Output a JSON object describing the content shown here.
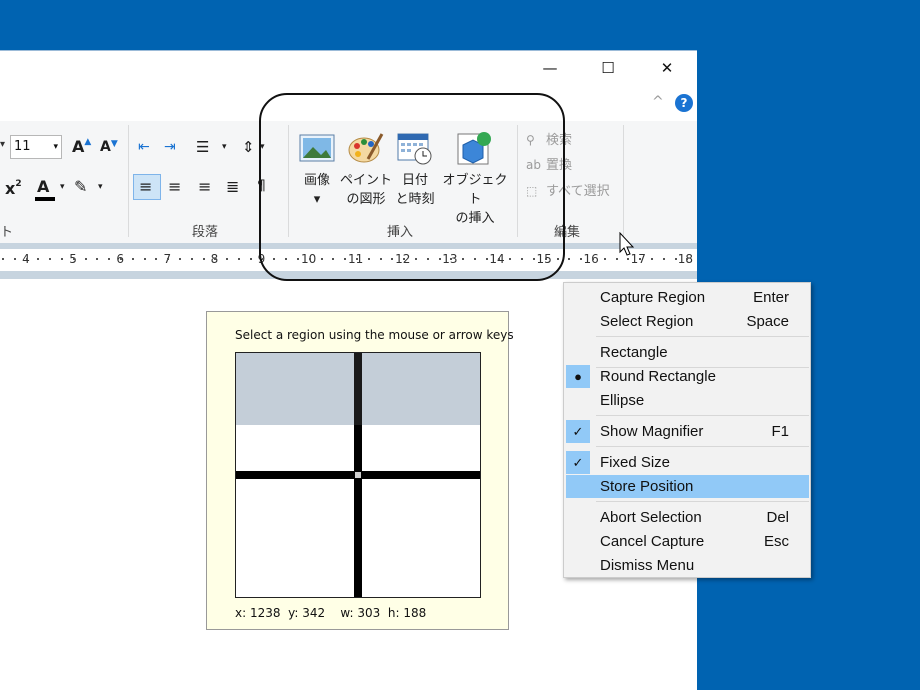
{
  "window": {
    "minimize": "—",
    "maximize": "☐",
    "close": "✕",
    "collapse": "^",
    "help": "?"
  },
  "ribbon": {
    "font_size": "11",
    "group_labels": {
      "font": "ト",
      "paragraph": "段落",
      "insert": "挿入",
      "edit": "編集"
    },
    "insert_buttons": [
      {
        "line1": "画像",
        "line2": "▾"
      },
      {
        "line1": "ペイント",
        "line2": "の図形"
      },
      {
        "line1": "日付",
        "line2": "と時刻"
      },
      {
        "line1": "オブジェクト",
        "line2": "の挿入"
      }
    ],
    "edit_items": [
      "検索",
      "置換",
      "すべて選択"
    ]
  },
  "ruler": {
    "numbers": [
      "4",
      "5",
      "6",
      "7",
      "8",
      "9",
      "10",
      "11",
      "12",
      "13",
      "14",
      "15",
      "16",
      "17",
      "18"
    ]
  },
  "capture": {
    "hint": "Select a region using the mouse or arrow keys",
    "coords": "x: 1238  y: 342    w: 303  h: 188"
  },
  "context_menu": {
    "items": [
      {
        "label": "Capture Region",
        "key": "Enter"
      },
      {
        "label": "Select Region",
        "key": "Space"
      },
      {
        "label": "Rectangle",
        "key": ""
      },
      {
        "label": "Round Rectangle",
        "key": "",
        "mark": "●"
      },
      {
        "label": "Ellipse",
        "key": ""
      },
      {
        "label": "Show Magnifier",
        "key": "F1",
        "mark": "✓"
      },
      {
        "label": "Fixed Size",
        "key": "",
        "mark": "✓"
      },
      {
        "label": "Store Position",
        "key": ""
      },
      {
        "label": "Abort Selection",
        "key": "Del"
      },
      {
        "label": "Cancel Capture",
        "key": "Esc"
      },
      {
        "label": "Dismiss Menu",
        "key": ""
      }
    ]
  },
  "colors": {
    "desktop": "#0063b1",
    "highlight": "#91c9f7",
    "menu_bg": "#f2f2f2",
    "capture_bg": "#ffffe6"
  }
}
